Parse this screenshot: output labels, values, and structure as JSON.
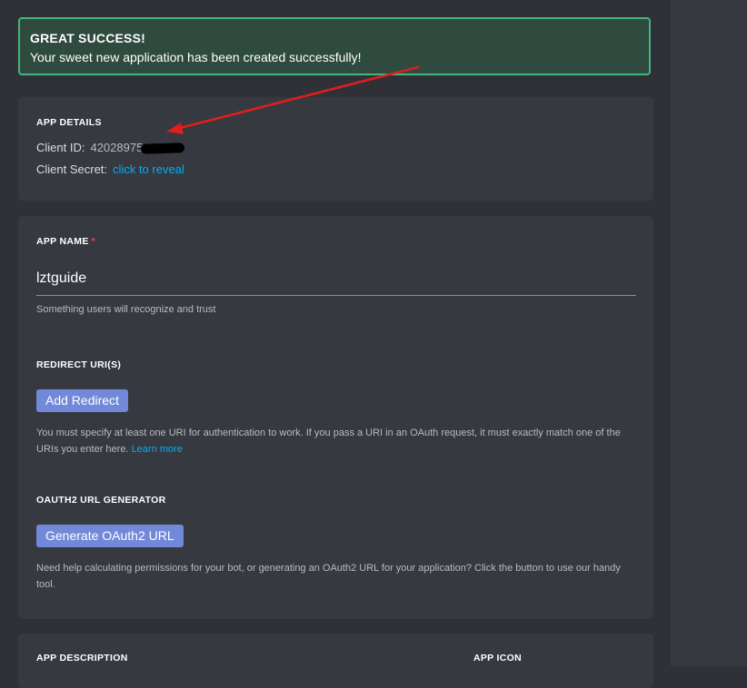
{
  "success": {
    "title": "GREAT SUCCESS!",
    "message": "Your sweet new application has been created successfully!"
  },
  "app_details": {
    "heading": "APP DETAILS",
    "client_id_label": "Client ID:",
    "client_id_value": "42028975",
    "client_secret_label": "Client Secret:",
    "client_secret_link": "click to reveal"
  },
  "app_name": {
    "heading": "APP NAME",
    "required_mark": "*",
    "value": "lztguide",
    "hint": "Something users will recognize and trust"
  },
  "redirect": {
    "heading": "REDIRECT URI(S)",
    "button": "Add Redirect",
    "hint": "You must specify at least one URI for authentication to work. If you pass a URI in an OAuth request, it must exactly match one of the URIs you enter here.",
    "learn_more": "Learn more"
  },
  "oauth2": {
    "heading": "OAUTH2 URL GENERATOR",
    "button": "Generate OAuth2 URL",
    "hint": "Need help calculating permissions for your bot, or generating an OAuth2 URL for your application? Click the button to use our handy tool."
  },
  "description": {
    "heading": "APP DESCRIPTION"
  },
  "icon": {
    "heading": "APP ICON"
  },
  "colors": {
    "accent": "#7289da",
    "success": "#43b581",
    "link": "#00b0f4",
    "annotation": "#e01e1e"
  },
  "icons": {
    "annotation": "red-arrow-icon"
  }
}
